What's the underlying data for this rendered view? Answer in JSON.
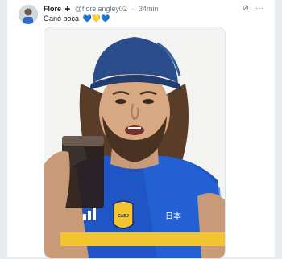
{
  "tweet": {
    "display_name": "Flore",
    "badge": "✚",
    "handle": "@florelangley02",
    "separator": "·",
    "time": "34min",
    "text": "Ganó boca",
    "hearts": [
      "💙",
      "💛",
      "💙"
    ],
    "icons": {
      "grok": "grok-icon",
      "more": "more-icon"
    }
  },
  "image": {
    "jersey_badge": "CABJ",
    "jersey_sponsor": "日本",
    "brand_colors": {
      "jersey": "#1f55c4",
      "cap": "#2a4c8a",
      "gold": "#f2c530"
    }
  }
}
